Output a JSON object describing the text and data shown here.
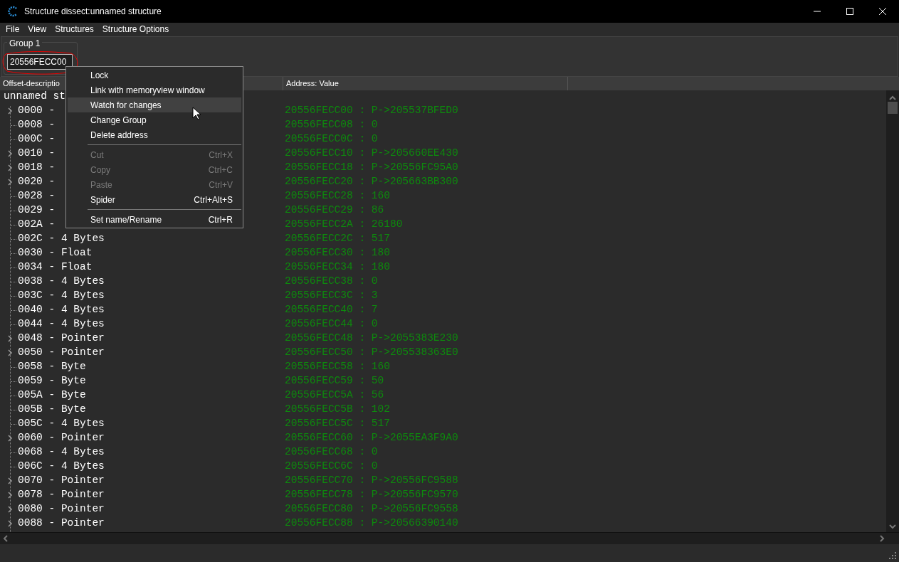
{
  "window": {
    "title": "Structure dissect:unnamed structure"
  },
  "menu_bar": [
    "File",
    "View",
    "Structures",
    "Structure Options"
  ],
  "group": {
    "label": "Group 1",
    "address": "20556FECC00"
  },
  "columns": [
    "Offset-descriptio",
    "Address: Value"
  ],
  "tree": {
    "root": "unnamed st",
    "rows": [
      {
        "offset": "0000 -",
        "value": "20556FECC00 : P->205537BFED0",
        "expandable": true
      },
      {
        "offset": "0008 -",
        "value": "20556FECC08 : 0",
        "expandable": false
      },
      {
        "offset": "000C -",
        "value": "20556FECC0C : 0",
        "expandable": false
      },
      {
        "offset": "0010 -",
        "value": "20556FECC10 : P->205660EE430",
        "expandable": true
      },
      {
        "offset": "0018 -",
        "value": "20556FECC18 : P->20556FC95A0",
        "expandable": true
      },
      {
        "offset": "0020 -",
        "value": "20556FECC20 : P->205663BB300",
        "expandable": true
      },
      {
        "offset": "0028 -",
        "value": "20556FECC28 : 160",
        "expandable": false
      },
      {
        "offset": "0029 -",
        "value": "20556FECC29 : 86",
        "expandable": false
      },
      {
        "offset": "002A -",
        "value": "20556FECC2A : 26180",
        "expandable": false
      },
      {
        "offset": "002C - 4 Bytes",
        "value": "20556FECC2C : 517",
        "expandable": false
      },
      {
        "offset": "0030 - Float",
        "value": "20556FECC30 : 180",
        "expandable": false
      },
      {
        "offset": "0034 - Float",
        "value": "20556FECC34 : 180",
        "expandable": false
      },
      {
        "offset": "0038 - 4 Bytes",
        "value": "20556FECC38 : 0",
        "expandable": false
      },
      {
        "offset": "003C - 4 Bytes",
        "value": "20556FECC3C : 3",
        "expandable": false
      },
      {
        "offset": "0040 - 4 Bytes",
        "value": "20556FECC40 : 7",
        "expandable": false
      },
      {
        "offset": "0044 - 4 Bytes",
        "value": "20556FECC44 : 0",
        "expandable": false
      },
      {
        "offset": "0048 - Pointer",
        "value": "20556FECC48 : P->2055383E230",
        "expandable": true
      },
      {
        "offset": "0050 - Pointer",
        "value": "20556FECC50 : P->205538363E0",
        "expandable": true
      },
      {
        "offset": "0058 - Byte",
        "value": "20556FECC58 : 160",
        "expandable": false
      },
      {
        "offset": "0059 - Byte",
        "value": "20556FECC59 : 50",
        "expandable": false
      },
      {
        "offset": "005A - Byte",
        "value": "20556FECC5A : 56",
        "expandable": false
      },
      {
        "offset": "005B - Byte",
        "value": "20556FECC5B : 102",
        "expandable": false
      },
      {
        "offset": "005C - 4 Bytes",
        "value": "20556FECC5C : 517",
        "expandable": false
      },
      {
        "offset": "0060 - Pointer",
        "value": "20556FECC60 : P->2055EA3F9A0",
        "expandable": true
      },
      {
        "offset": "0068 - 4 Bytes",
        "value": "20556FECC68 : 0",
        "expandable": false
      },
      {
        "offset": "006C - 4 Bytes",
        "value": "20556FECC6C : 0",
        "expandable": false
      },
      {
        "offset": "0070 - Pointer",
        "value": "20556FECC70 : P->20556FC9588",
        "expandable": true
      },
      {
        "offset": "0078 - Pointer",
        "value": "20556FECC78 : P->20556FC9570",
        "expandable": true
      },
      {
        "offset": "0080 - Pointer",
        "value": "20556FECC80 : P->20556FC9558",
        "expandable": true
      },
      {
        "offset": "0088 - Pointer",
        "value": "20556FECC88 : P->20566390140",
        "expandable": true
      }
    ]
  },
  "context_menu": {
    "items": [
      {
        "kind": "item",
        "label": "Lock",
        "selected": false,
        "disabled": false
      },
      {
        "kind": "item",
        "label": "Link with memoryview window",
        "selected": false,
        "disabled": false
      },
      {
        "kind": "item",
        "label": "Watch for changes",
        "selected": true,
        "disabled": false
      },
      {
        "kind": "item",
        "label": "Change Group",
        "selected": false,
        "disabled": false
      },
      {
        "kind": "item",
        "label": "Delete address",
        "selected": false,
        "disabled": false
      },
      {
        "kind": "separator"
      },
      {
        "kind": "item",
        "label": "Cut",
        "shortcut": "Ctrl+X",
        "selected": false,
        "disabled": true
      },
      {
        "kind": "item",
        "label": "Copy",
        "shortcut": "Ctrl+C",
        "selected": false,
        "disabled": true
      },
      {
        "kind": "item",
        "label": "Paste",
        "shortcut": "Ctrl+V",
        "selected": false,
        "disabled": true
      },
      {
        "kind": "item",
        "label": "Spider",
        "shortcut": "Ctrl+Alt+S",
        "selected": false,
        "disabled": false
      },
      {
        "kind": "separator"
      },
      {
        "kind": "item",
        "label": "Set name/Rename",
        "shortcut": "Ctrl+R",
        "selected": false,
        "disabled": false
      }
    ]
  }
}
